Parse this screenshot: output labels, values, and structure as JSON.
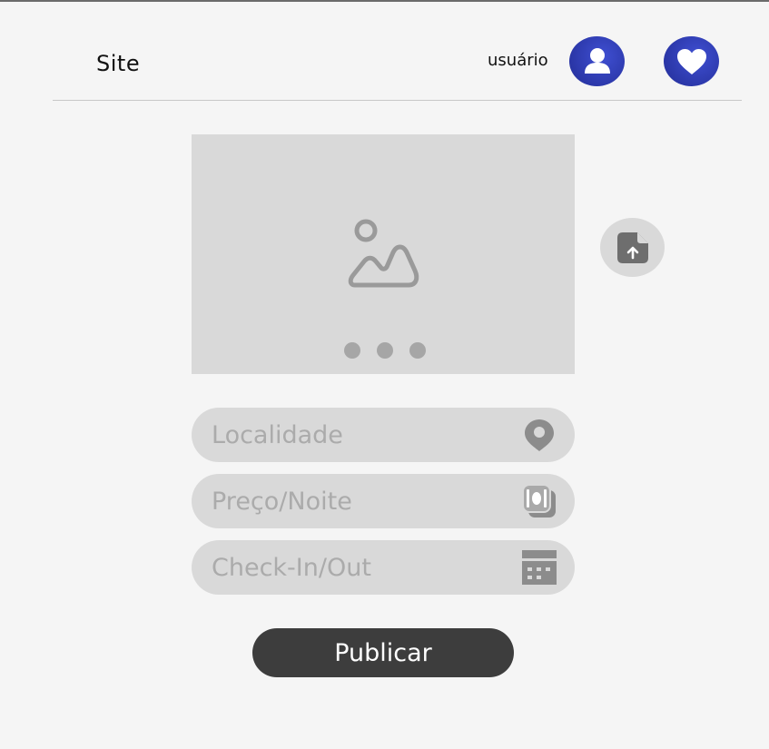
{
  "header": {
    "brand": "Site",
    "user_label": "usuário"
  },
  "icons": {
    "avatar": "user-icon",
    "favorites": "heart-icon",
    "image_placeholder": "image-icon",
    "upload": "file-upload-icon",
    "location": "map-pin-icon",
    "price": "money-icon",
    "checkin": "calendar-icon"
  },
  "colors": {
    "accent": "#2b37a8",
    "background": "#f5f5f5",
    "panel": "#d9d9d9",
    "button": "#3d3d3d"
  },
  "carousel": {
    "slide_count": 3
  },
  "form": {
    "location": {
      "value": "",
      "placeholder": "Localidade"
    },
    "price": {
      "value": "",
      "placeholder": "Preço/Noite"
    },
    "checkin": {
      "value": "",
      "placeholder": "Check-In/Out"
    },
    "submit_label": "Publicar"
  }
}
